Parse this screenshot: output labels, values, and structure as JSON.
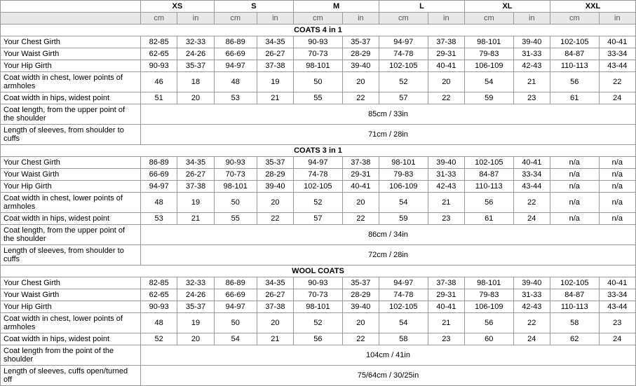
{
  "table": {
    "size_headers": [
      "XS",
      "S",
      "M",
      "L",
      "XL",
      "XXL"
    ],
    "unit_pairs": [
      [
        "cm",
        "in"
      ],
      [
        "cm",
        "in"
      ],
      [
        "cm",
        "in"
      ],
      [
        "cm",
        "in"
      ],
      [
        "cm",
        "in"
      ],
      [
        "cm",
        "in"
      ]
    ],
    "sections": [
      {
        "title": "COATS 4 in 1",
        "rows": [
          {
            "label": "Your Chest Girth",
            "cells": [
              "82-85",
              "32-33",
              "86-89",
              "34-35",
              "90-93",
              "35-37",
              "94-97",
              "37-38",
              "98-101",
              "39-40",
              "102-105",
              "40-41"
            ]
          },
          {
            "label": "Your Waist Girth",
            "cells": [
              "62-65",
              "24-26",
              "66-69",
              "26-27",
              "70-73",
              "28-29",
              "74-78",
              "29-31",
              "79-83",
              "31-33",
              "84-87",
              "33-34"
            ]
          },
          {
            "label": "Your Hip Girth",
            "cells": [
              "90-93",
              "35-37",
              "94-97",
              "37-38",
              "98-101",
              "39-40",
              "102-105",
              "40-41",
              "106-109",
              "42-43",
              "110-113",
              "43-44"
            ]
          },
          {
            "label": "Coat width in chest, lower points of armholes",
            "cells": [
              "46",
              "18",
              "48",
              "19",
              "50",
              "20",
              "52",
              "20",
              "54",
              "21",
              "56",
              "22"
            ]
          },
          {
            "label": "Coat width in hips, widest point",
            "cells": [
              "51",
              "20",
              "53",
              "21",
              "55",
              "22",
              "57",
              "22",
              "59",
              "23",
              "61",
              "24"
            ]
          },
          {
            "label": "Coat length, from the upper point of the shoulder",
            "span_text": "85cm / 33in"
          },
          {
            "label": "Length of sleeves, from shoulder to cuffs",
            "span_text": "71cm / 28in"
          }
        ]
      },
      {
        "title": "COATS 3 in 1",
        "rows": [
          {
            "label": "Your Chest Girth",
            "cells": [
              "86-89",
              "34-35",
              "90-93",
              "35-37",
              "94-97",
              "37-38",
              "98-101",
              "39-40",
              "102-105",
              "40-41",
              "n/a",
              "n/a"
            ]
          },
          {
            "label": "Your Waist Girth",
            "cells": [
              "66-69",
              "26-27",
              "70-73",
              "28-29",
              "74-78",
              "29-31",
              "79-83",
              "31-33",
              "84-87",
              "33-34",
              "n/a",
              "n/a"
            ]
          },
          {
            "label": "Your Hip Girth",
            "cells": [
              "94-97",
              "37-38",
              "98-101",
              "39-40",
              "102-105",
              "40-41",
              "106-109",
              "42-43",
              "110-113",
              "43-44",
              "n/a",
              "n/a"
            ]
          },
          {
            "label": "Coat width in chest, lower points of armholes",
            "cells": [
              "48",
              "19",
              "50",
              "20",
              "52",
              "20",
              "54",
              "21",
              "56",
              "22",
              "n/a",
              "n/a"
            ]
          },
          {
            "label": "Coat width in hips, widest point",
            "cells": [
              "53",
              "21",
              "55",
              "22",
              "57",
              "22",
              "59",
              "23",
              "61",
              "24",
              "n/a",
              "n/a"
            ]
          },
          {
            "label": "Coat length, from the upper point of the shoulder",
            "span_text": "86cm / 34in"
          },
          {
            "label": "Length of sleeves, from shoulder to cuffs",
            "span_text": "72cm / 28in"
          }
        ]
      },
      {
        "title": "WOOL COATS",
        "rows": [
          {
            "label": "Your Chest Girth",
            "cells": [
              "82-85",
              "32-33",
              "86-89",
              "34-35",
              "90-93",
              "35-37",
              "94-97",
              "37-38",
              "98-101",
              "39-40",
              "102-105",
              "40-41"
            ]
          },
          {
            "label": "Your Waist Girth",
            "cells": [
              "62-65",
              "24-26",
              "66-69",
              "26-27",
              "70-73",
              "28-29",
              "74-78",
              "29-31",
              "79-83",
              "31-33",
              "84-87",
              "33-34"
            ]
          },
          {
            "label": "Your Hip Girth",
            "cells": [
              "90-93",
              "35-37",
              "94-97",
              "37-38",
              "98-101",
              "39-40",
              "102-105",
              "40-41",
              "106-109",
              "42-43",
              "110-113",
              "43-44"
            ]
          },
          {
            "label": "Coat width in chest, lower points of armholes",
            "cells": [
              "48",
              "19",
              "50",
              "20",
              "52",
              "20",
              "54",
              "21",
              "56",
              "22",
              "58",
              "23"
            ]
          },
          {
            "label": "Coat width in hips, widest point",
            "cells": [
              "52",
              "20",
              "54",
              "21",
              "56",
              "22",
              "58",
              "23",
              "60",
              "24",
              "62",
              "24"
            ]
          },
          {
            "label": "Coat length from the point of the shoulder",
            "span_text": "104cm / 41in"
          },
          {
            "label": "Length of sleeves, cuffs open/turned off",
            "span_text": "75/64cm / 30/25in"
          }
        ]
      }
    ]
  }
}
